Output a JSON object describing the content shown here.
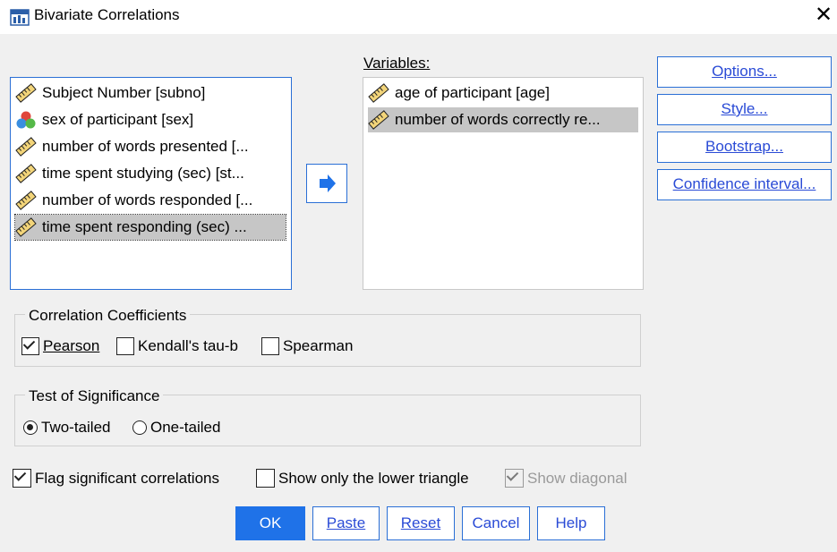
{
  "window": {
    "title": "Bivariate Correlations",
    "close_glyph": "✕"
  },
  "source_list": {
    "items": [
      {
        "label": "Subject Number [subno]",
        "icon": "ruler-icon",
        "selected": false
      },
      {
        "label": "sex of participant [sex]",
        "icon": "nominal-icon",
        "selected": false
      },
      {
        "label": "number of words presented [...",
        "icon": "ruler-icon",
        "selected": false
      },
      {
        "label": "time spent studying (sec) [st...",
        "icon": "ruler-icon",
        "selected": false
      },
      {
        "label": "number of words responded [...",
        "icon": "ruler-icon",
        "selected": false
      },
      {
        "label": "time spent responding (sec) ...",
        "icon": "ruler-icon",
        "selected": true
      }
    ]
  },
  "variables": {
    "label": "Variables:",
    "items": [
      {
        "label": "age of participant [age]",
        "icon": "ruler-icon",
        "selected": false
      },
      {
        "label": "number of words correctly re...",
        "icon": "ruler-icon",
        "selected": true
      }
    ]
  },
  "side_buttons": {
    "options": "Options...",
    "style": "Style...",
    "bootstrap": "Bootstrap...",
    "confidence": "Confidence interval..."
  },
  "coefficients": {
    "legend": "Correlation Coefficients",
    "pearson": {
      "label": "Pearson",
      "checked": true
    },
    "kendall": {
      "label": "Kendall's tau-b",
      "checked": false
    },
    "spearman": {
      "label": "Spearman",
      "checked": false
    }
  },
  "significance": {
    "legend": "Test of Significance",
    "two_tailed": {
      "label": "Two-tailed",
      "selected": true
    },
    "one_tailed": {
      "label": "One-tailed",
      "selected": false
    }
  },
  "flags": {
    "flag_significant": {
      "label": "Flag significant correlations",
      "checked": true
    },
    "lower_triangle": {
      "label": "Show only the lower triangle",
      "checked": false
    },
    "show_diagonal": {
      "label": "Show diagonal",
      "checked": true,
      "disabled": true
    }
  },
  "bottom_buttons": {
    "ok": "OK",
    "paste": "Paste",
    "reset": "Reset",
    "cancel": "Cancel",
    "help": "Help"
  },
  "colors": {
    "accent": "#1f72e8",
    "link": "#2a4bd6",
    "selection": "#c6c6c6"
  }
}
